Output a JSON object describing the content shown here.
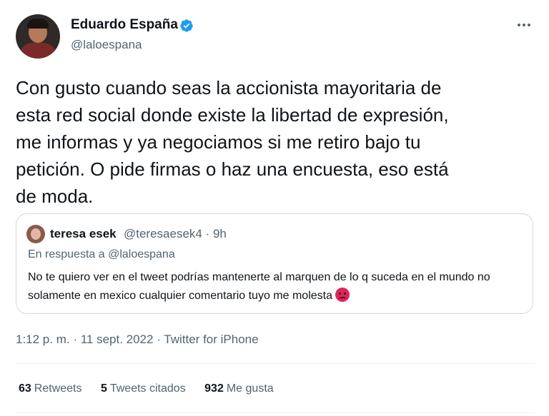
{
  "tweet": {
    "author": {
      "name": "Eduardo España",
      "handle": "@laloespana",
      "verified": true
    },
    "text": "Con gusto cuando seas la accionista mayoritaria de\nesta red social donde existe la libertad de expresión,\nme informas y ya negociamos si me retiro bajo tu\npetición. O pide firmas o haz una encuesta, eso está\nde moda.",
    "quoted": {
      "name": "teresa esek",
      "handle_time": "@teresaesek4 · 9h",
      "reply_to": "En respuesta a @laloespana",
      "text": "No te quiero ver en el tweet podrías mantenerte al marquen de lo q suceda en el mundo no solamente en mexico cualquier comentario tuyo me molesta"
    },
    "timestamp": "1:12 p. m. · 11 sept. 2022 · ",
    "source": "Twitter for iPhone",
    "stats": {
      "retweets_count": "63",
      "retweets_label": "Retweets",
      "quotes_count": "5",
      "quotes_label": "Tweets citados",
      "likes_count": "932",
      "likes_label": "Me gusta"
    }
  },
  "icons": {
    "verified": "verified-badge-icon",
    "more": "more-horizontal-icon",
    "emoji": "angry-face-emoji"
  },
  "colors": {
    "verified": "#1d9bf0",
    "secondary_text": "#536471",
    "border": "#cfd9de"
  }
}
